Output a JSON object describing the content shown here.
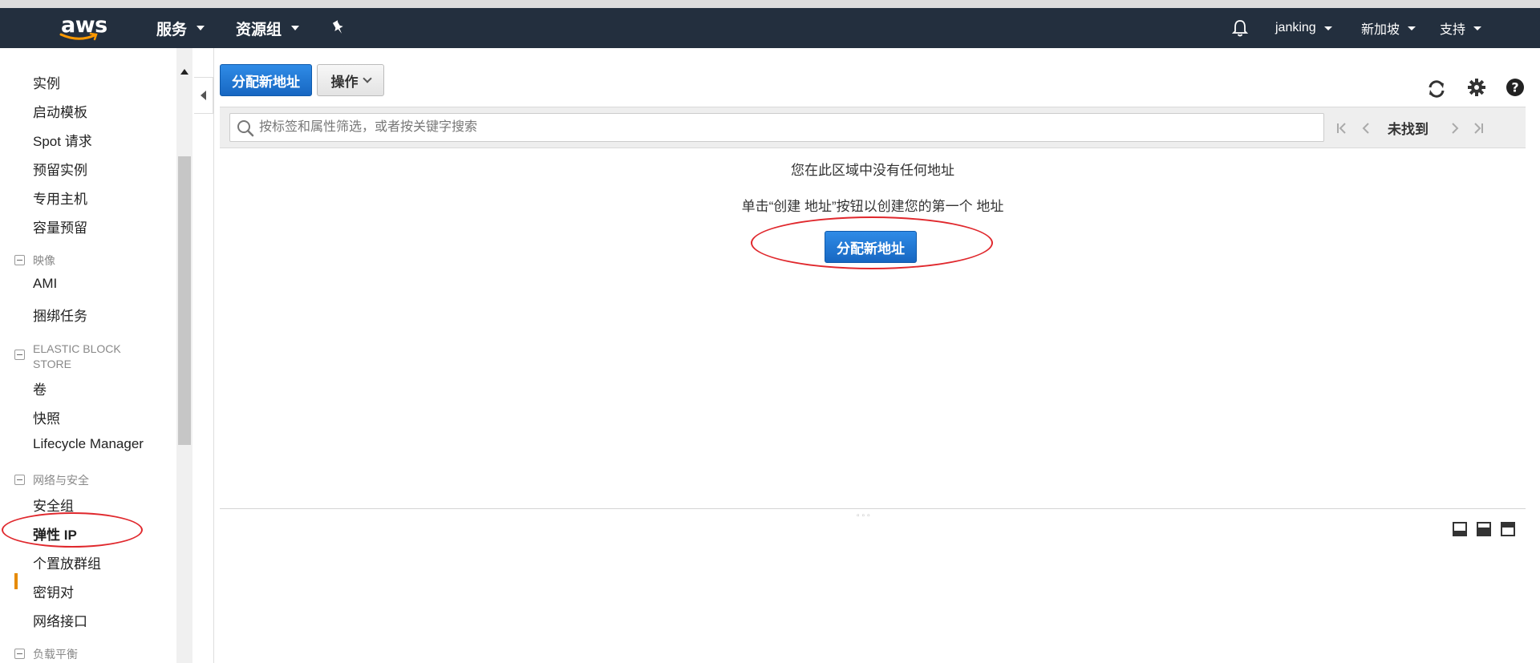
{
  "nav": {
    "logo": "aws",
    "services": "服务",
    "resource_groups": "资源组",
    "pin_icon": "pin-icon",
    "bell_icon": "bell-icon",
    "user": "janking",
    "region": "新加坡",
    "support": "支持"
  },
  "sidebar": {
    "items_top": [
      "实例",
      "启动模板",
      "Spot 请求",
      "预留实例",
      "专用主机",
      "容量预留"
    ],
    "section_images": "映像",
    "items_images": [
      "AMI",
      "捆绑任务"
    ],
    "section_ebs": "ELASTIC BLOCK STORE",
    "items_ebs": [
      "卷",
      "快照",
      "Lifecycle Manager"
    ],
    "section_network": "网络与安全",
    "items_network": [
      "安全组",
      "弹性 IP",
      "个置放群组",
      "密钥对",
      "网络接口"
    ],
    "active_item": "弹性 IP",
    "section_lb": "负载平衡"
  },
  "toolbar": {
    "allocate_label": "分配新地址",
    "actions_label": "操作",
    "refresh_icon": "refresh-icon",
    "settings_icon": "gear-icon",
    "help_icon": "help-icon"
  },
  "filter": {
    "placeholder": "按标签和属性筛选，或者按关键字搜索",
    "pager_status": "未找到"
  },
  "empty_state": {
    "line1": "您在此区域中没有任何地址",
    "line2": "单击“创建 地址”按钮以创建您的第一个 地址",
    "button_label": "分配新地址"
  },
  "colors": {
    "navbar": "#232f3e",
    "primary": "#1f77d4",
    "active_marker": "#e68a00",
    "annotation": "#e0282d"
  }
}
